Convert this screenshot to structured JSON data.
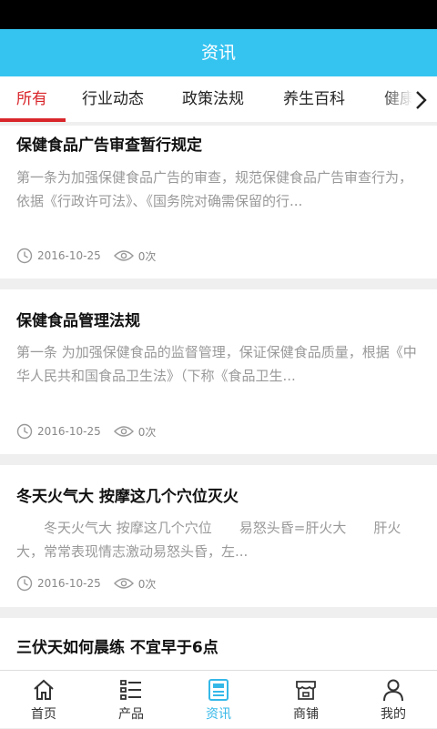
{
  "header": {
    "title": "资讯"
  },
  "tabs": [
    {
      "label": "所有"
    },
    {
      "label": "行业动态"
    },
    {
      "label": "政策法规"
    },
    {
      "label": "养生百科"
    },
    {
      "label": "健康"
    }
  ],
  "articles": [
    {
      "title": "保健食品广告审查暂行规定",
      "desc": "第一条为加强保健食品广告的审查，规范保健食品广告审查行为，依据《行政许可法》、《国务院对确需保留的行...",
      "date": "2016-10-25",
      "views": "0次"
    },
    {
      "title": "保健食品管理法规",
      "desc": "第一条 为加强保健食品的监督管理，保证保健食品质量，根据《中华人民共和国食品卫生法》（下称《食品卫生...",
      "date": "2016-10-25",
      "views": "0次"
    },
    {
      "title": "冬天火气大 按摩这几个穴位灭火",
      "desc": "　　冬天火气大 按摩这几个穴位　　易怒头昏=肝火大　　肝火大，常常表现情志激动易怒头昏，左...",
      "date": "2016-10-25",
      "views": "0次"
    },
    {
      "title": "三伏天如何晨练 不宜早于6点"
    }
  ],
  "bottom_nav": [
    {
      "label": "首页",
      "icon": "home-icon"
    },
    {
      "label": "产品",
      "icon": "list-icon"
    },
    {
      "label": "资讯",
      "icon": "news-icon",
      "active": true
    },
    {
      "label": "商铺",
      "icon": "shop-icon"
    },
    {
      "label": "我的",
      "icon": "user-icon"
    }
  ],
  "colors": {
    "header": "#35c3f0",
    "active_tab": "#d9262b",
    "active_nav": "#35b8e8"
  }
}
